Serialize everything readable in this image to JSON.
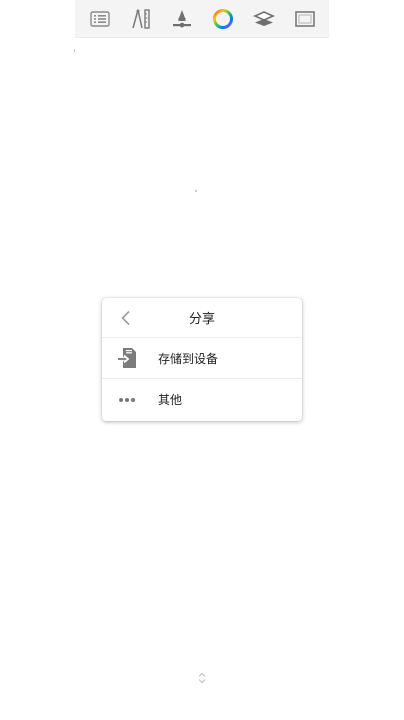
{
  "toolbar": {
    "tools": [
      {
        "name": "list-icon"
      },
      {
        "name": "ruler-pen-icon"
      },
      {
        "name": "brush-icon"
      },
      {
        "name": "color-wheel-icon"
      },
      {
        "name": "layers-icon"
      },
      {
        "name": "canvas-frame-icon"
      }
    ]
  },
  "share_menu": {
    "back_icon": "chevron-left-icon",
    "title": "分享",
    "items": [
      {
        "icon": "save-to-device-icon",
        "label": "存储到设备"
      },
      {
        "icon": "more-dots-icon",
        "label": "其他"
      }
    ]
  },
  "bottom": {
    "handle_icon": "expand-handle-icon"
  }
}
